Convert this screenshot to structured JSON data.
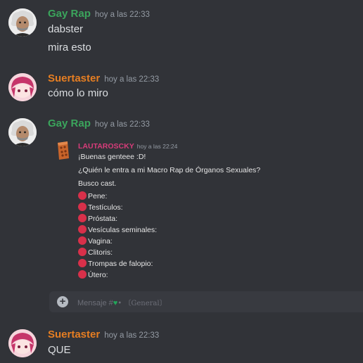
{
  "messages": [
    {
      "author": "Gay Rap",
      "author_color": "#3ba55c",
      "timestamp": "hoy a las 22:33",
      "avatar": "einstein-avatar",
      "lines": [
        "dabster",
        "mira esto"
      ]
    },
    {
      "author": "Suertaster",
      "author_color": "#e67e22",
      "timestamp": "hoy a las 22:33",
      "avatar": "anime-avatar",
      "lines": [
        "cómo lo miro"
      ]
    },
    {
      "author": "Gay Rap",
      "author_color": "#3ba55c",
      "timestamp": "hoy a las 22:33",
      "avatar": "einstein-avatar",
      "embed": {
        "author": "LAUTAROSCKY",
        "author_color": "#d83c7a",
        "timestamp": "hoy a las 22:24",
        "avatar": "brick-avatar",
        "lines": [
          "¡Buenas genteee :D!",
          "¿Quién le entra a mi Macro Rap de Órganos Sexuales?",
          "Busco cast."
        ],
        "roles": [
          "Pene:",
          "Testículos:",
          "Próstata:",
          "Vesículas seminales:",
          "Vagina:",
          "Clitoris:",
          "Trompas de falopio:",
          "Útero:"
        ],
        "bullet_color": "#d8304a",
        "composer": {
          "placeholder_prefix": "Mensaje #",
          "placeholder_suffix": "• 〔General〕",
          "plus_icon": "plus-circle-icon",
          "heart_icon": "green-heart-icon"
        }
      }
    },
    {
      "author": "Suertaster",
      "author_color": "#e67e22",
      "timestamp": "hoy a las 22:33",
      "avatar": "anime-avatar",
      "lines": [
        "QUE"
      ]
    }
  ]
}
